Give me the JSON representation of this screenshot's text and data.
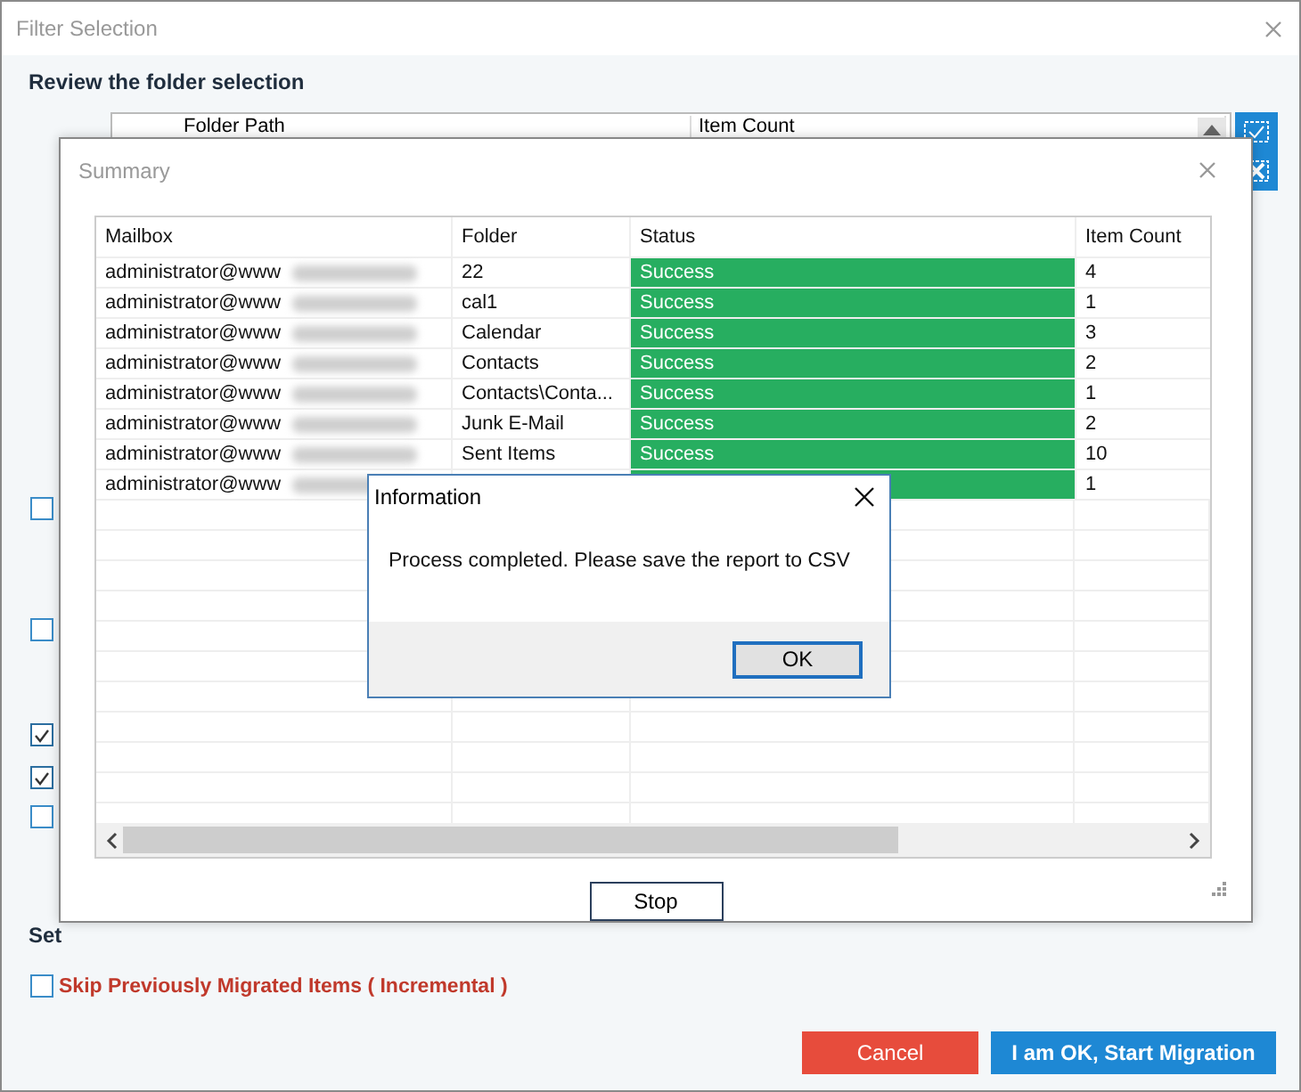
{
  "window": {
    "title": "Filter Selection",
    "heading": "Review the folder selection"
  },
  "folder_table": {
    "columns": [
      "Folder Path",
      "Item Count"
    ]
  },
  "left_checkboxes": [
    {
      "checked": false
    },
    {
      "checked": false
    },
    {
      "checked": true
    },
    {
      "checked": true
    },
    {
      "checked": false
    }
  ],
  "settings_heading": "Set",
  "incremental": {
    "label": "Skip Previously Migrated Items ( Incremental )",
    "checked": false
  },
  "buttons": {
    "cancel": "Cancel",
    "start": "I am OK, Start Migration"
  },
  "summary": {
    "title": "Summary",
    "columns": [
      "Mailbox",
      "Folder",
      "Status",
      "Item Count"
    ],
    "rows": [
      {
        "mailbox": "administrator@www",
        "folder": "22",
        "status": "Success",
        "success": true,
        "count": "4"
      },
      {
        "mailbox": "administrator@www",
        "folder": "cal1",
        "status": "Success",
        "success": true,
        "count": "1"
      },
      {
        "mailbox": "administrator@www",
        "folder": "Calendar",
        "status": "Success",
        "success": true,
        "count": "3"
      },
      {
        "mailbox": "administrator@www",
        "folder": "Contacts",
        "status": "Success",
        "success": true,
        "count": "2"
      },
      {
        "mailbox": "administrator@www",
        "folder": "Contacts\\Conta...",
        "status": "Success",
        "success": true,
        "count": "1"
      },
      {
        "mailbox": "administrator@www",
        "folder": "Junk E-Mail",
        "status": "Success",
        "success": true,
        "count": "2"
      },
      {
        "mailbox": "administrator@www",
        "folder": "Sent Items",
        "status": "Success",
        "success": true,
        "count": "10"
      },
      {
        "mailbox": "administrator@www",
        "success": true,
        "count": "1"
      }
    ],
    "stop": "Stop"
  },
  "info": {
    "title": "Information",
    "message": "Process completed. Please save the report to CSV",
    "ok": "OK"
  }
}
